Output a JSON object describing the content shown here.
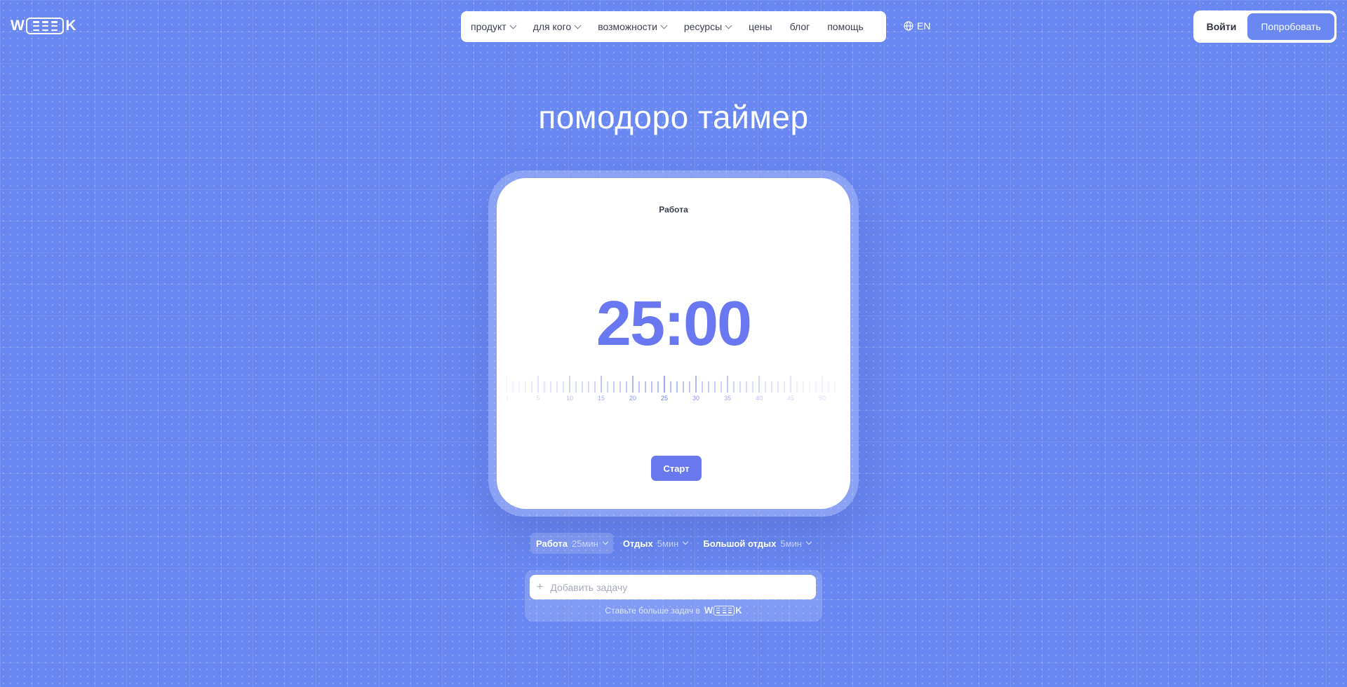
{
  "logo": {
    "letters_left": "W",
    "letters_right": "K",
    "name": "WEEEK"
  },
  "nav": {
    "items": [
      {
        "label": "продукт",
        "has_dropdown": true
      },
      {
        "label": "для кого",
        "has_dropdown": true
      },
      {
        "label": "возможности",
        "has_dropdown": true
      },
      {
        "label": "ресурсы",
        "has_dropdown": true
      },
      {
        "label": "цены",
        "has_dropdown": false
      },
      {
        "label": "блог",
        "has_dropdown": false
      },
      {
        "label": "помощь",
        "has_dropdown": false
      }
    ]
  },
  "lang": {
    "icon": "globe-icon",
    "label": "EN"
  },
  "auth": {
    "login_label": "Войти",
    "try_label": "Попробовать"
  },
  "page": {
    "title": "помодоро таймер"
  },
  "timer": {
    "mode_label": "Работа",
    "time": "25:00",
    "ruler_labels": [
      "0",
      "5",
      "10",
      "15",
      "20",
      "25",
      "30",
      "35",
      "40",
      "45",
      "50"
    ],
    "current_minutes": 25,
    "start_label": "Старт"
  },
  "settings": [
    {
      "name": "Работа",
      "value": "25мин",
      "active": true
    },
    {
      "name": "Отдых",
      "value": "5мин",
      "active": false
    },
    {
      "name": "Большой отдых",
      "value": "5мин",
      "active": false
    }
  ],
  "task": {
    "placeholder": "Добавить задачу",
    "promo_text": "Ставьте больше задач в"
  },
  "colors": {
    "background": "#6987f1",
    "accent": "#6a78f0",
    "card": "#ffffff"
  }
}
